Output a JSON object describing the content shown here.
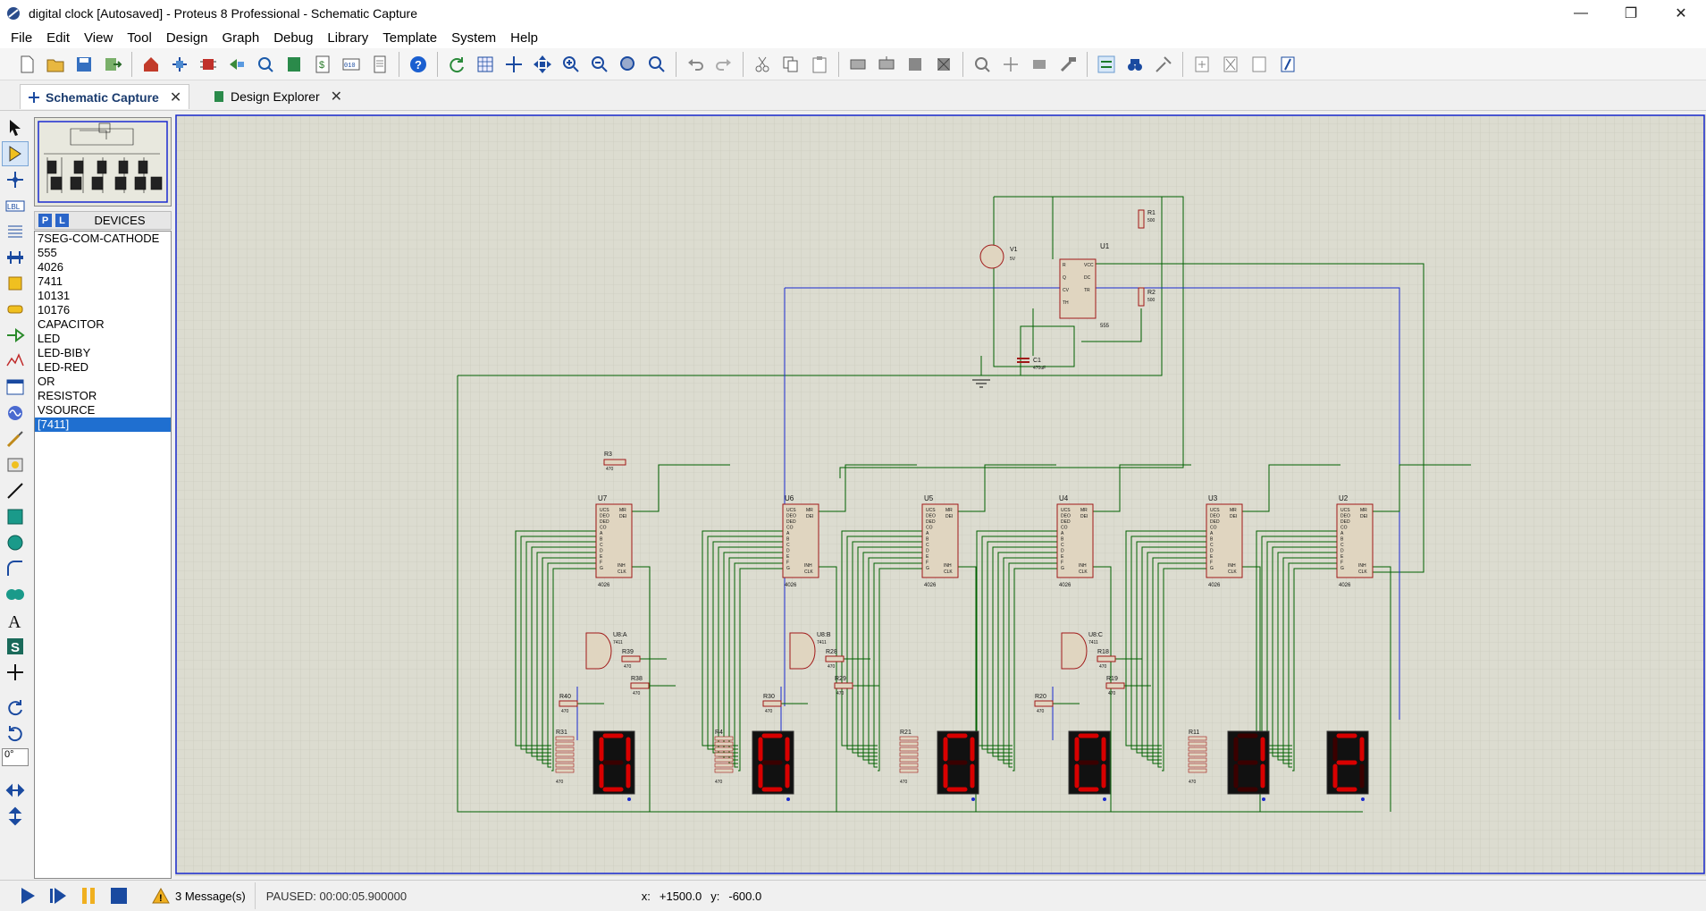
{
  "window": {
    "title": "digital clock [Autosaved] - Proteus 8 Professional - Schematic Capture",
    "min": "—",
    "max": "❐",
    "close": "✕"
  },
  "menu": [
    "File",
    "Edit",
    "View",
    "Tool",
    "Design",
    "Graph",
    "Debug",
    "Library",
    "Template",
    "System",
    "Help"
  ],
  "tabs": [
    {
      "label": "Schematic Capture",
      "close": "✕"
    },
    {
      "label": "Design Explorer",
      "close": "✕"
    }
  ],
  "devices": {
    "p_label": "P",
    "l_label": "L",
    "header": "DEVICES",
    "items": [
      "7SEG-COM-CATHODE",
      "555",
      "4026",
      "7411",
      "10131",
      "10176",
      "CAPACITOR",
      "LED",
      "LED-BIBY",
      "LED-RED",
      "OR",
      "RESISTOR",
      "VSOURCE",
      "[7411]"
    ],
    "selected_index": 13
  },
  "rotation": {
    "value": "0°"
  },
  "schematic": {
    "counters": [
      "U7",
      "U6",
      "U5",
      "U4",
      "U3",
      "U2"
    ],
    "counter_part": "4026",
    "displays": [
      "0",
      "0",
      "0",
      "0",
      "1",
      "2"
    ],
    "timer": {
      "name": "U1",
      "part": "555"
    },
    "source": {
      "name": "V1",
      "value": "5V"
    },
    "r1": {
      "name": "R1",
      "value": "500"
    },
    "r2": {
      "name": "R2",
      "value": "500"
    },
    "r3": {
      "name": "R3",
      "value": "470"
    },
    "c1": {
      "name": "C1",
      "value": "470uF"
    },
    "gates": [
      {
        "name": "U8:A",
        "part": "7411"
      },
      {
        "name": "U8:B",
        "part": "7411"
      },
      {
        "name": "U8:C",
        "part": "7411"
      }
    ],
    "gate_resistors": [
      [
        "R39",
        "R38",
        "R40"
      ],
      [
        "R28",
        "R29",
        "R30"
      ],
      [
        "R18",
        "R19",
        "R20"
      ]
    ],
    "display_resistors": [
      "R31",
      "R4",
      "R21",
      "R11"
    ],
    "res_value": "470",
    "accent_wire": "#006000",
    "accent_bus": "#1a2ad0",
    "accent_part": "#a01818",
    "seg_on": "#d80000",
    "seg_off": "#3a0000"
  },
  "status": {
    "messages": "3 Message(s)",
    "sim_status": "PAUSED: 00:00:05.900000",
    "x_label": "x:",
    "x_value": "+1500.0",
    "y_label": "y:",
    "y_value": "-600.0"
  }
}
